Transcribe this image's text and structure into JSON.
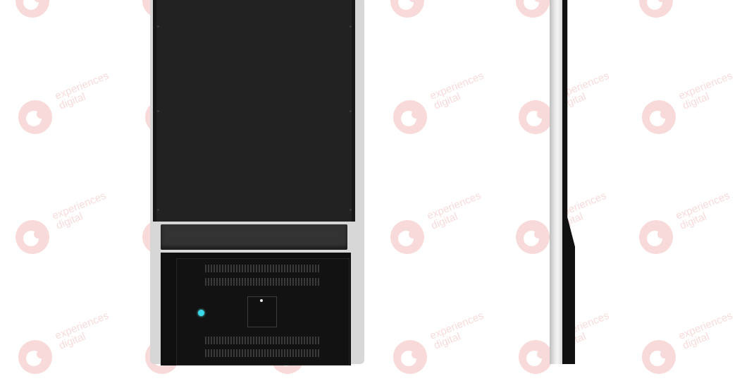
{
  "watermark": {
    "line1": "experiences",
    "line2": "digital",
    "logo_icon": "ed-logo-icon",
    "color": "#e35a5a"
  },
  "product": {
    "front_view_icon": "kiosk-front-icon",
    "side_view_icon": "kiosk-side-icon",
    "screen_color": "#222222",
    "frame_color": "#d7d7d7",
    "led_color": "#38d8e8"
  }
}
